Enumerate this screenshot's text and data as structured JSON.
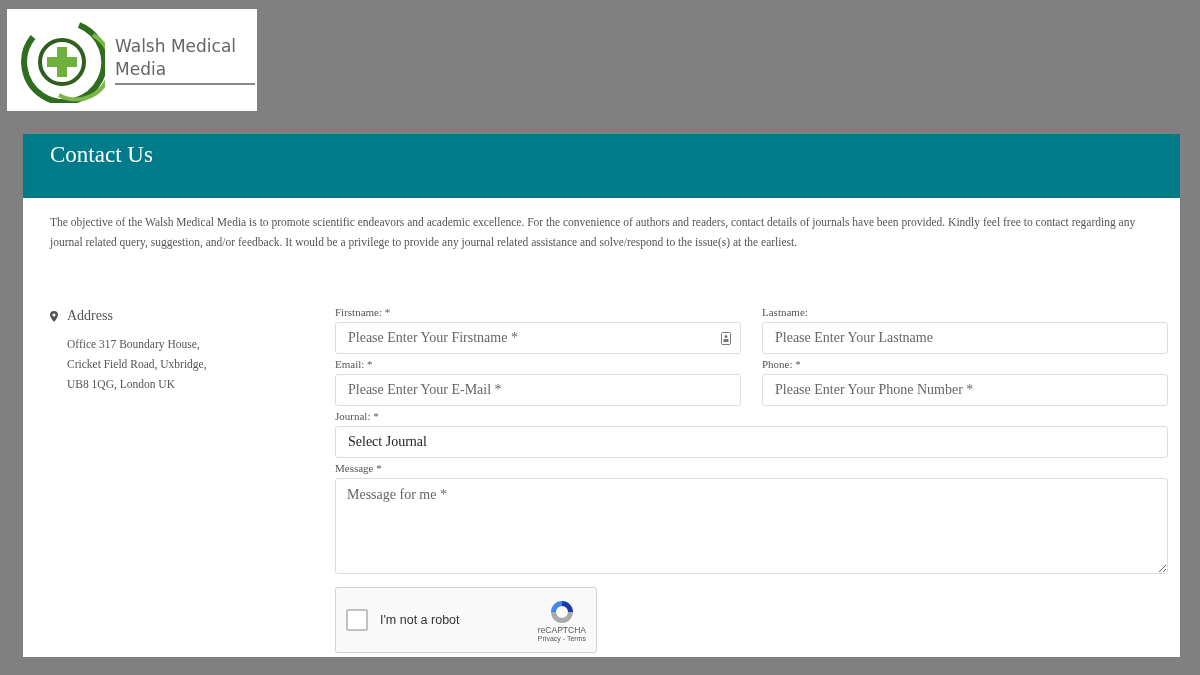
{
  "logo": {
    "text": "Walsh Medical Media"
  },
  "header": {
    "title": "Contact Us"
  },
  "intro": "The objective of the Walsh Medical Media is to promote scientific endeavors and academic excellence. For the convenience of authors and readers, contact details of journals have been provided. Kindly feel free to contact regarding any journal related query, suggestion, and/or feedback. It would be a privilege to provide any journal related assistance and solve/respond to the issue(s) at the earliest.",
  "address": {
    "heading": "Address",
    "lines": [
      "Office 317 Boundary House,",
      "Cricket Field Road, Uxbridge,",
      "UB8 1QG, London UK"
    ]
  },
  "form": {
    "fields": [
      {
        "kind": "input",
        "label": "Firstname: *",
        "placeholder": "Please Enter Your Firstname *",
        "autofill_icon": true
      },
      {
        "kind": "input",
        "label": "Lastname:",
        "placeholder": "Please Enter Your Lastname",
        "autofill_icon": false
      },
      {
        "kind": "input",
        "label": "Email: *",
        "placeholder": "Please Enter Your E-Mail *",
        "autofill_icon": false
      },
      {
        "kind": "input",
        "label": "Phone: *",
        "placeholder": "Please Enter Your Phone Number *",
        "autofill_icon": false
      },
      {
        "kind": "select",
        "label": "Journal: *",
        "value": "Select Journal"
      },
      {
        "kind": "textarea",
        "label": "Message *",
        "placeholder": "Message for me *"
      }
    ],
    "captcha": {
      "label": "I'm not a robot",
      "checked": false,
      "brand": "reCAPTCHA",
      "links": "Privacy - Terms"
    }
  }
}
